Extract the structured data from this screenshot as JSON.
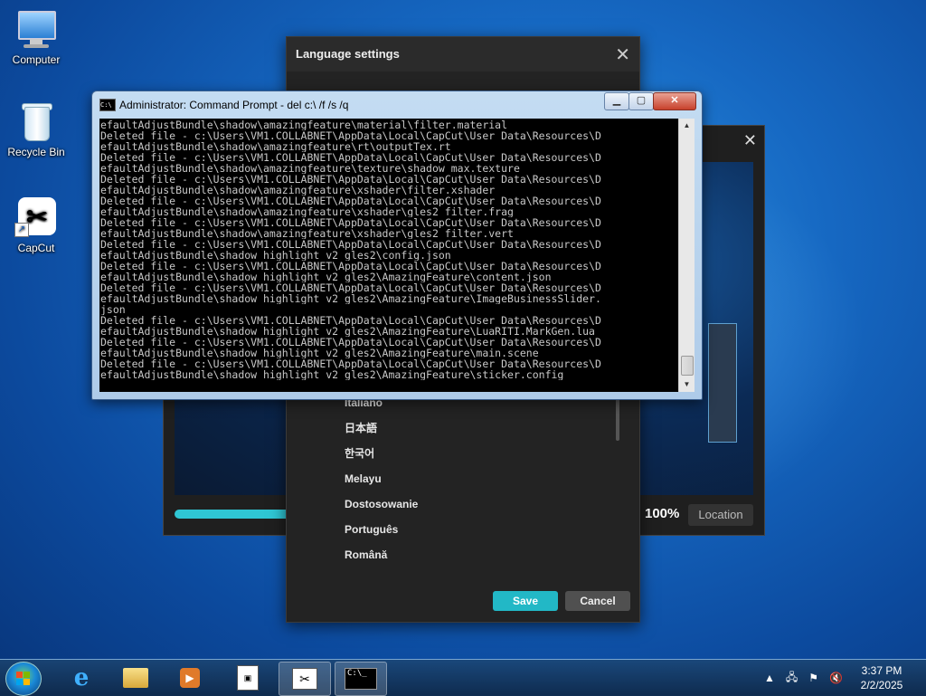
{
  "desktop": {
    "icons": [
      {
        "label": "Computer",
        "icon": "computer-icon"
      },
      {
        "label": "Recycle Bin",
        "icon": "recycle-bin-icon"
      },
      {
        "label": "CapCut",
        "icon": "capcut-shortcut-icon"
      }
    ]
  },
  "capcut_window": {
    "progress_percent": "100%",
    "location_label": "Location",
    "progress_fraction": 1.0
  },
  "language_dialog": {
    "title": "Language settings",
    "languages": [
      "Italiano",
      "日本語",
      "한국어",
      "Melayu",
      "Dostosowanie",
      "Português",
      "Română"
    ],
    "save_label": "Save",
    "cancel_label": "Cancel",
    "accent_color": "#22b8c6"
  },
  "cmd_window": {
    "title": "Administrator:  Command Prompt - del  c:\\ /f /s /q",
    "lines": [
      "efaultAdjustBundle\\shadow\\amazingfeature\\material\\filter.material",
      "Deleted file - c:\\Users\\VM1.COLLABNET\\AppData\\Local\\CapCut\\User Data\\Resources\\D",
      "efaultAdjustBundle\\shadow\\amazingfeature\\rt\\outputTex.rt",
      "Deleted file - c:\\Users\\VM1.COLLABNET\\AppData\\Local\\CapCut\\User Data\\Resources\\D",
      "efaultAdjustBundle\\shadow\\amazingfeature\\texture\\shadow_max.texture",
      "Deleted file - c:\\Users\\VM1.COLLABNET\\AppData\\Local\\CapCut\\User Data\\Resources\\D",
      "efaultAdjustBundle\\shadow\\amazingfeature\\xshader\\filter.xshader",
      "Deleted file - c:\\Users\\VM1.COLLABNET\\AppData\\Local\\CapCut\\User Data\\Resources\\D",
      "efaultAdjustBundle\\shadow\\amazingfeature\\xshader\\gles2_filter.frag",
      "Deleted file - c:\\Users\\VM1.COLLABNET\\AppData\\Local\\CapCut\\User Data\\Resources\\D",
      "efaultAdjustBundle\\shadow\\amazingfeature\\xshader\\gles2_filter.vert",
      "Deleted file - c:\\Users\\VM1.COLLABNET\\AppData\\Local\\CapCut\\User Data\\Resources\\D",
      "efaultAdjustBundle\\shadow_highlight_v2_gles2\\config.json",
      "Deleted file - c:\\Users\\VM1.COLLABNET\\AppData\\Local\\CapCut\\User Data\\Resources\\D",
      "efaultAdjustBundle\\shadow_highlight_v2_gles2\\AmazingFeature\\content.json",
      "Deleted file - c:\\Users\\VM1.COLLABNET\\AppData\\Local\\CapCut\\User Data\\Resources\\D",
      "efaultAdjustBundle\\shadow_highlight_v2_gles2\\AmazingFeature\\ImageBusinessSlider.",
      "json",
      "Deleted file - c:\\Users\\VM1.COLLABNET\\AppData\\Local\\CapCut\\User Data\\Resources\\D",
      "efaultAdjustBundle\\shadow_highlight_v2_gles2\\AmazingFeature\\LuaRITI.MarkGen.lua",
      "Deleted file - c:\\Users\\VM1.COLLABNET\\AppData\\Local\\CapCut\\User Data\\Resources\\D",
      "efaultAdjustBundle\\shadow_highlight_v2_gles2\\AmazingFeature\\main.scene",
      "Deleted file - c:\\Users\\VM1.COLLABNET\\AppData\\Local\\CapCut\\User Data\\Resources\\D",
      "efaultAdjustBundle\\shadow_highlight_v2_gles2\\AmazingFeature\\sticker.config"
    ]
  },
  "taskbar": {
    "items": [
      "start-orb",
      "internet-explorer-icon",
      "file-explorer-icon",
      "media-player-icon",
      "app-window-icon",
      "capcut-taskbar-icon",
      "command-prompt-icon"
    ],
    "clock_time": "3:37 PM",
    "clock_date": "2/2/2025"
  }
}
